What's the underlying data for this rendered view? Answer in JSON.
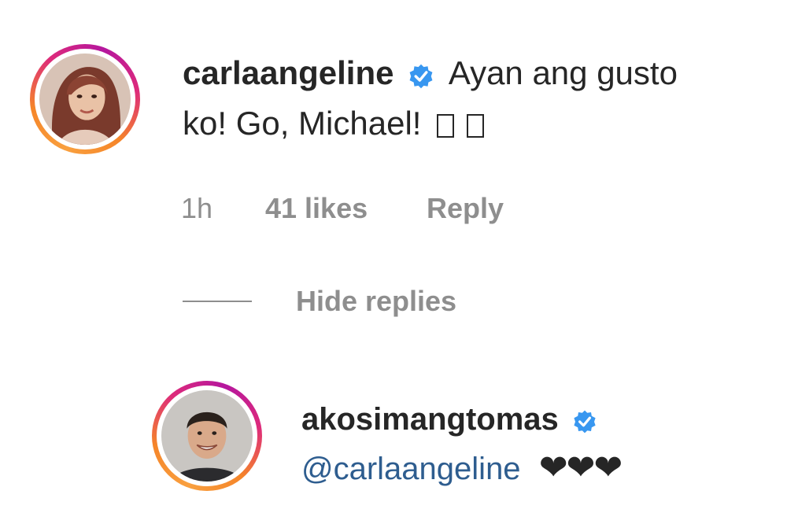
{
  "comments": [
    {
      "username": "carlaangeline",
      "verified": true,
      "text_line1": "Ayan ang gusto",
      "text_line2": "ko! Go, Michael!",
      "avatar_icon": "profile-photo-woman",
      "time": "1h",
      "likes": "41 likes",
      "reply_label": "Reply"
    }
  ],
  "replies_toggle": {
    "label": "Hide replies"
  },
  "replies": [
    {
      "username": "akosimangtomas",
      "verified": true,
      "mention": "@carlaangeline",
      "hearts": "❤❤❤",
      "avatar_icon": "profile-photo-man"
    }
  ],
  "colors": {
    "text": "#262626",
    "meta": "#8e8e8e",
    "mention": "#2e5d8f",
    "verified": "#3897f0",
    "ring_start": "#f58529",
    "ring_end": "#dd2a7b"
  }
}
